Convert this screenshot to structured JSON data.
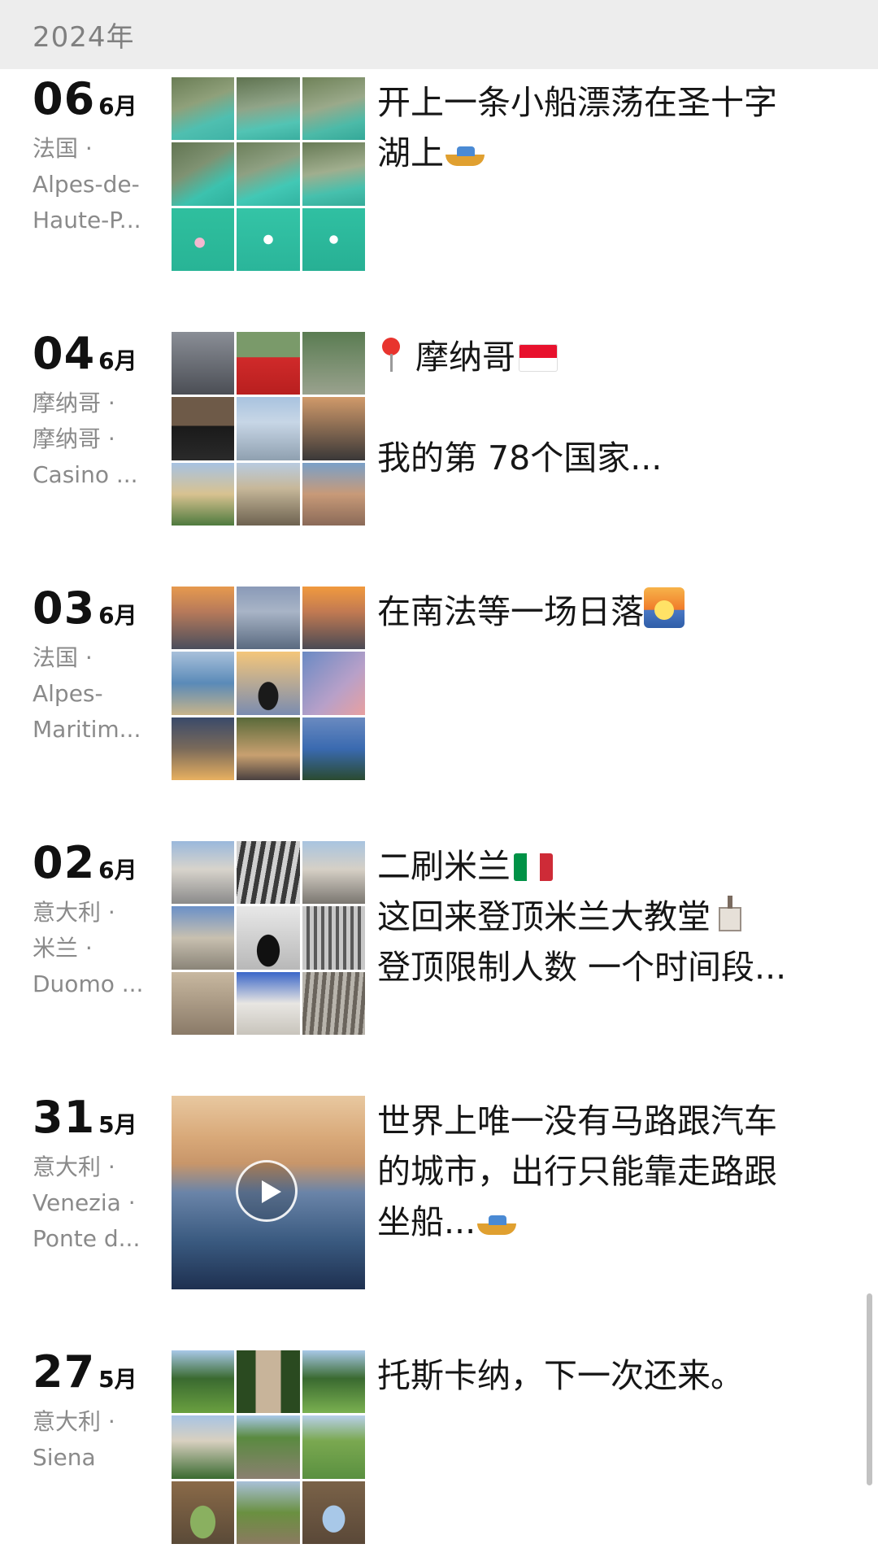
{
  "header": {
    "year": "2024年"
  },
  "posts": [
    {
      "day": "06",
      "month": "6月",
      "location": [
        "法国 ·",
        "Alpes-de-",
        "Haute-P..."
      ],
      "text": [
        "开上一条小船漂荡在圣十字",
        "湖上"
      ],
      "thumbnails": [
        "lake-cliffs",
        "lake-cliffs",
        "lake-cliffs",
        "lake-cliffs",
        "lake-cliffs",
        "lake-cliffs",
        "boat-on-lake",
        "boat-on-lake",
        "boat-on-lake"
      ]
    },
    {
      "day": "04",
      "month": "6月",
      "location": [
        "摩纳哥 ·",
        "摩纳哥 ·",
        "Casino ..."
      ],
      "text": [
        "摩纳哥",
        "",
        "我的第 78个国家..."
      ],
      "thumbnails": [
        "building",
        "red-bus",
        "street",
        "car",
        "harbor-view",
        "street",
        "palace",
        "palace",
        "city-view"
      ]
    },
    {
      "day": "03",
      "month": "6月",
      "location": [
        "法国 ·",
        "Alpes-",
        "Maritim..."
      ],
      "text": [
        "在南法等一场日落"
      ],
      "thumbnails": [
        "sunset-city",
        "coast",
        "sunset-city",
        "bay",
        "person-sunset",
        "sky-plane",
        "night-coast",
        "palm-street",
        "cliff-sea"
      ]
    },
    {
      "day": "02",
      "month": "6月",
      "location": [
        "意大利 ·",
        "米兰 ·",
        "Duomo ..."
      ],
      "text": [
        "二刷米兰",
        "这回来登顶米兰大教堂",
        "登顶限制人数 一个时间段..."
      ],
      "thumbnails": [
        "cathedral",
        "cathedral-bw",
        "cathedral",
        "cathedral",
        "silhouette",
        "cathedral-bw",
        "statue",
        "cathedral",
        "spires"
      ]
    },
    {
      "day": "31",
      "month": "5月",
      "location": [
        "意大利 ·",
        "Venezia ·",
        "Ponte d..."
      ],
      "text": [
        "世界上唯一没有马路跟汽车",
        "的城市，出行只能靠走路跟",
        "坐船..."
      ],
      "thumbnails": [
        "venice-video"
      ]
    },
    {
      "day": "27",
      "month": "5月",
      "location": [
        "意大利 ·",
        "Siena"
      ],
      "text": [
        "托斯卡纳，下一次还来。"
      ],
      "thumbnails": [
        "cypress-field",
        "cypress-road",
        "cypress-field",
        "chapel",
        "cypress-road",
        "hills",
        "arch",
        "hills",
        "arch"
      ]
    }
  ]
}
